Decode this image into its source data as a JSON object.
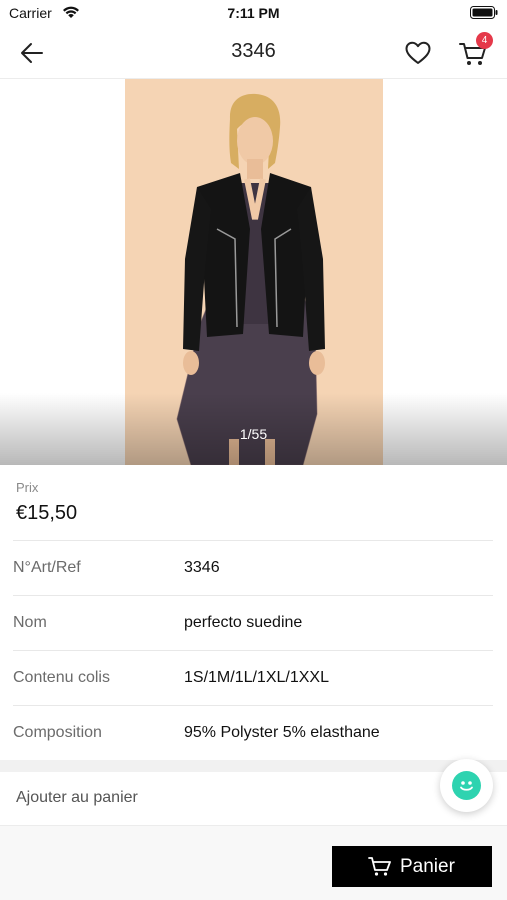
{
  "status_bar": {
    "carrier": "Carrier",
    "time": "7:11 PM"
  },
  "header": {
    "title": "3346",
    "cart_count": "4"
  },
  "gallery": {
    "counter": "1/55"
  },
  "price": {
    "label": "Prix",
    "value": "€15,50"
  },
  "details": [
    {
      "key": "N°Art/Ref",
      "value": "3346"
    },
    {
      "key": "Nom",
      "value": "perfecto suedine"
    },
    {
      "key": "Contenu colis",
      "value": "1S/1M/1L/1XL/1XXL"
    },
    {
      "key": "Composition",
      "value": "95% Polyster 5% elasthane"
    }
  ],
  "add_to_cart": {
    "label": "Ajouter au panier"
  },
  "footer": {
    "button_label": "Panier"
  },
  "colors": {
    "badge": "#e5394a",
    "chat": "#2ed3b0",
    "photo_bg": "#f5d4b4"
  },
  "icons": [
    "wifi-icon",
    "battery-icon",
    "back-arrow-icon",
    "heart-icon",
    "cart-icon",
    "chat-icon"
  ]
}
